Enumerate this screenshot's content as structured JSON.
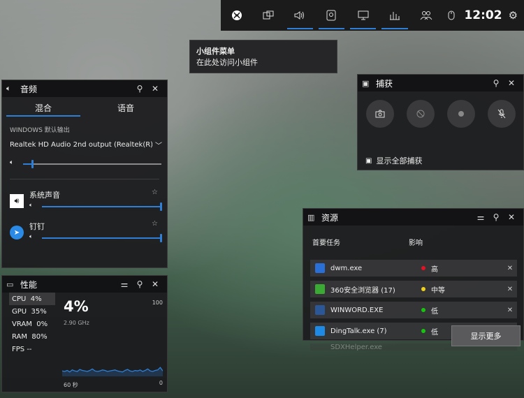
{
  "topbar": {
    "clock": "12:02",
    "buttons": [
      "xbox-icon",
      "widget-menu-icon",
      "audio-icon",
      "capture-icon",
      "display-icon",
      "performance-icon",
      "social-icon"
    ]
  },
  "tooltip": {
    "title": "小组件菜单",
    "text": "在此处访问小组件"
  },
  "audio": {
    "title": "音频",
    "tabs": [
      "混合",
      "语音"
    ],
    "output_label": "WINDOWS 默认输出",
    "device": "Realtek HD Audio 2nd output (Realtek(R)...",
    "master_volume": 0.06,
    "apps": [
      {
        "name": "系统声音",
        "volume": 1.0
      },
      {
        "name": "钉钉",
        "volume": 1.0
      }
    ]
  },
  "capture": {
    "title": "捕获",
    "show_all": "显示全部捕获"
  },
  "performance": {
    "title": "性能",
    "rows": [
      {
        "label": "CPU",
        "value": "4%"
      },
      {
        "label": "GPU",
        "value": "35%"
      },
      {
        "label": "VRAM",
        "value": "0%"
      },
      {
        "label": "RAM",
        "value": "80%"
      },
      {
        "label": "FPS",
        "value": "--"
      }
    ],
    "big_value": "4%",
    "freq": "2.90 GHz",
    "max_label": "100",
    "min_label": "0",
    "duration": "60 秒",
    "graph": [
      0.08,
      0.07,
      0.09,
      0.06,
      0.1,
      0.08,
      0.07,
      0.11,
      0.09,
      0.08,
      0.07,
      0.09,
      0.12,
      0.08,
      0.07,
      0.08,
      0.1,
      0.09,
      0.07,
      0.08,
      0.09,
      0.1,
      0.08,
      0.07,
      0.06,
      0.09,
      0.11,
      0.08,
      0.07,
      0.09,
      0.08,
      0.1,
      0.07,
      0.09,
      0.12,
      0.08,
      0.07,
      0.09,
      0.1,
      0.15,
      0.08
    ]
  },
  "resources": {
    "title": "资源",
    "col_task": "首要任务",
    "col_impact": "影响",
    "rows": [
      {
        "name": "dwm.exe",
        "impact": "高",
        "color": "#e81123",
        "icon_color": "#2a6fd6",
        "closable": true
      },
      {
        "name": "360安全浏览器 (17)",
        "impact": "中等",
        "color": "#f1d21a",
        "icon_color": "#3aaa35",
        "closable": true
      },
      {
        "name": "WINWORD.EXE",
        "impact": "低",
        "color": "#16c60c",
        "icon_color": "#2b5797",
        "closable": true
      },
      {
        "name": "DingTalk.exe (7)",
        "impact": "低",
        "color": "#16c60c",
        "icon_color": "#1e8ae6",
        "closable": false
      },
      {
        "name": "SDXHelper.exe",
        "impact": "",
        "color": "",
        "icon_color": "",
        "closable": false
      }
    ],
    "show_more": "显示更多"
  }
}
